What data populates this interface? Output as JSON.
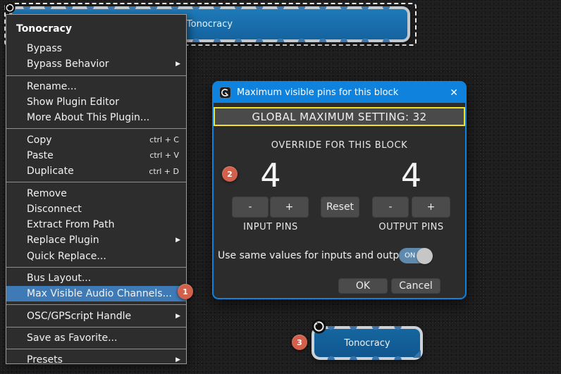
{
  "canvas": {
    "top_block": {
      "label": "Tonocracy"
    },
    "bottom_block": {
      "label": "Tonocracy"
    }
  },
  "menu": {
    "header": "Tonocracy",
    "items": [
      {
        "label": "Bypass"
      },
      {
        "label": "Bypass Behavior",
        "submenu": true
      },
      {
        "separator": true
      },
      {
        "label": "Rename..."
      },
      {
        "label": "Show Plugin Editor"
      },
      {
        "label": "More About This Plugin..."
      },
      {
        "separator": true
      },
      {
        "label": "Copy",
        "shortcut": "ctrl + C"
      },
      {
        "label": "Paste",
        "shortcut": "ctrl + V"
      },
      {
        "label": "Duplicate",
        "shortcut": "ctrl + D"
      },
      {
        "separator": true
      },
      {
        "label": "Remove"
      },
      {
        "label": "Disconnect"
      },
      {
        "label": "Extract From Path"
      },
      {
        "label": "Replace Plugin",
        "submenu": true
      },
      {
        "label": "Quick Replace..."
      },
      {
        "separator": true
      },
      {
        "label": "Bus Layout..."
      },
      {
        "label": "Max Visible Audio Channels...",
        "highlighted": true
      },
      {
        "separator": true
      },
      {
        "label": "OSC/GPScript Handle",
        "submenu": true
      },
      {
        "separator": true
      },
      {
        "label": "Save as Favorite..."
      },
      {
        "separator": true
      },
      {
        "label": "Presets",
        "submenu": true
      }
    ]
  },
  "dialog": {
    "title": "Maximum visible pins for this block",
    "close_glyph": "✕",
    "global_max_text": "GLOBAL MAXIMUM SETTING: 32",
    "override_label": "OVERRIDE FOR THIS BLOCK",
    "input_value": "4",
    "output_value": "4",
    "minus_label": "-",
    "plus_label": "+",
    "reset_label": "Reset",
    "input_pins_label": "INPUT PINS",
    "output_pins_label": "OUTPUT PINS",
    "toggle_label": "Use same values for inputs and outputs",
    "toggle_state": "ON",
    "ok_label": "OK",
    "cancel_label": "Cancel"
  },
  "annotations": {
    "step1": "1",
    "step2": "2",
    "step3": "3"
  },
  "icons": {
    "submenu_arrow": "▶"
  },
  "colors": {
    "titlebar_blue": "#0f82de",
    "menu_highlight_blue": "#3d7ab6",
    "banner_yellow": "#f2e126",
    "badge_red": "#d2604a",
    "block_blue": "#15669f",
    "toggle_on_blue": "#5f89ad"
  }
}
